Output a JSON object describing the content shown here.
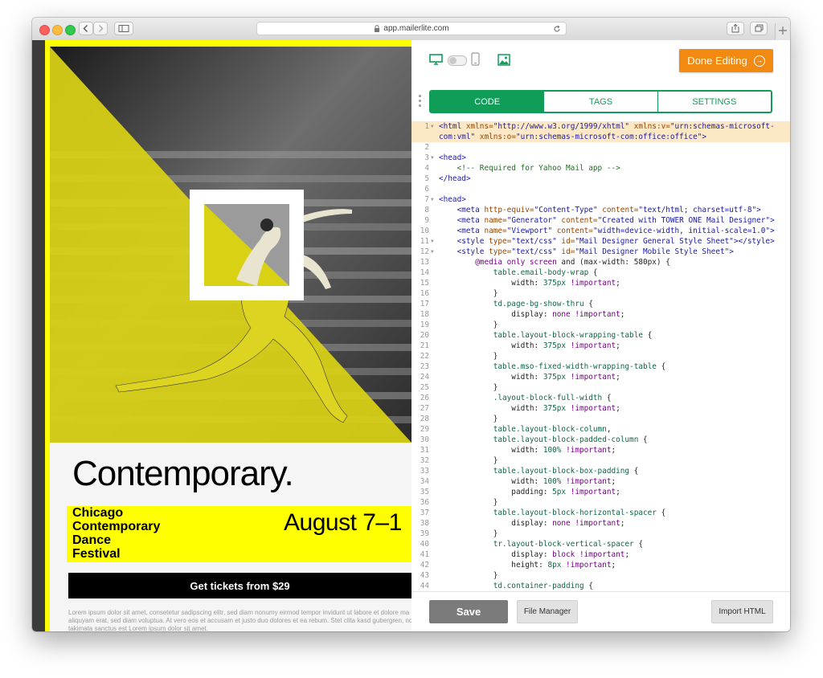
{
  "browser": {
    "url": "app.mailerlite.com"
  },
  "email": {
    "headline": "Contemporary.",
    "festival_lines": [
      "Chicago",
      "Contemporary",
      "Dance",
      "Festival"
    ],
    "dates": "August 7–1",
    "cta_label": "Get tickets from $29",
    "body_lines": [
      "Lorem ipsum dolor sit amet, consetetur sadipscing elitr, sed diam nonumy eirmod tempor invidunt ut labore et dolore ma",
      "aliquyam erat, sed diam voluptua. At vero eos et accusam et justo duo dolores et ea rebum. Stet clita kasd gubergren, no",
      "takimata sanctus est Lorem ipsum dolor sit amet."
    ],
    "colors": {
      "accent": "#ffff00",
      "text": "#000000"
    }
  },
  "editor": {
    "done_label": "Done Editing",
    "tabs": [
      {
        "label": "CODE",
        "active": true
      },
      {
        "label": "TAGS",
        "active": false
      },
      {
        "label": "SETTINGS",
        "active": false
      }
    ],
    "code_lines": [
      {
        "n": "1",
        "fold": true,
        "hl": true,
        "segs": [
          [
            "t",
            "<html "
          ],
          [
            "a",
            "xmlns="
          ],
          [
            "s",
            "\"http://www.w3.org/1999/xhtml\" "
          ],
          [
            "a",
            "xmlns:v="
          ],
          [
            "s",
            "\"urn:schemas-microsoft-"
          ]
        ]
      },
      {
        "n": "",
        "fold": false,
        "hl": true,
        "segs": [
          [
            "s",
            "com:vml\" "
          ],
          [
            "a",
            "xmlns:o="
          ],
          [
            "s",
            "\"urn:schemas-microsoft-com:office:office\""
          ],
          [
            "t",
            ">"
          ]
        ]
      },
      {
        "n": "2",
        "fold": false,
        "hl": false,
        "segs": []
      },
      {
        "n": "3",
        "fold": true,
        "hl": false,
        "segs": [
          [
            "t",
            "<head>"
          ]
        ]
      },
      {
        "n": "4",
        "fold": false,
        "hl": false,
        "segs": [
          [
            "p",
            "    "
          ],
          [
            "c",
            "<!-- Required for Yahoo Mail app -->"
          ]
        ]
      },
      {
        "n": "5",
        "fold": false,
        "hl": false,
        "segs": [
          [
            "t",
            "</head>"
          ]
        ]
      },
      {
        "n": "6",
        "fold": false,
        "hl": false,
        "segs": []
      },
      {
        "n": "7",
        "fold": true,
        "hl": false,
        "segs": [
          [
            "t",
            "<head>"
          ]
        ]
      },
      {
        "n": "8",
        "fold": false,
        "hl": false,
        "segs": [
          [
            "p",
            "    "
          ],
          [
            "t",
            "<meta "
          ],
          [
            "a",
            "http-equiv="
          ],
          [
            "s",
            "\"Content-Type\" "
          ],
          [
            "a",
            "content="
          ],
          [
            "s",
            "\"text/html; charset=utf-8\""
          ],
          [
            "t",
            ">"
          ]
        ]
      },
      {
        "n": "9",
        "fold": false,
        "hl": false,
        "segs": [
          [
            "p",
            "    "
          ],
          [
            "t",
            "<meta "
          ],
          [
            "a",
            "name="
          ],
          [
            "s",
            "\"Generator\" "
          ],
          [
            "a",
            "content="
          ],
          [
            "s",
            "\"Created with TOWER ONE Mail Designer\""
          ],
          [
            "t",
            ">"
          ]
        ]
      },
      {
        "n": "10",
        "fold": false,
        "hl": false,
        "segs": [
          [
            "p",
            "    "
          ],
          [
            "t",
            "<meta "
          ],
          [
            "a",
            "name="
          ],
          [
            "s",
            "\"Viewport\" "
          ],
          [
            "a",
            "content="
          ],
          [
            "s",
            "\"width=device-width, initial-scale=1.0\""
          ],
          [
            "t",
            ">"
          ]
        ]
      },
      {
        "n": "11",
        "fold": true,
        "hl": false,
        "segs": [
          [
            "p",
            "    "
          ],
          [
            "t",
            "<style "
          ],
          [
            "a",
            "type="
          ],
          [
            "s",
            "\"text/css\" "
          ],
          [
            "a",
            "id="
          ],
          [
            "s",
            "\"Mail Designer General Style Sheet\""
          ],
          [
            "t",
            "></style>"
          ]
        ]
      },
      {
        "n": "12",
        "fold": true,
        "hl": false,
        "segs": [
          [
            "p",
            "    "
          ],
          [
            "t",
            "<style "
          ],
          [
            "a",
            "type="
          ],
          [
            "s",
            "\"text/css\" "
          ],
          [
            "a",
            "id="
          ],
          [
            "s",
            "\"Mail Designer Mobile Style Sheet\""
          ],
          [
            "t",
            ">"
          ]
        ]
      },
      {
        "n": "13",
        "fold": false,
        "hl": false,
        "segs": [
          [
            "p",
            "        "
          ],
          [
            "k",
            "@media "
          ],
          [
            "k",
            "only screen "
          ],
          [
            "p",
            "and (max-width: 580px) {"
          ]
        ]
      },
      {
        "n": "14",
        "fold": false,
        "hl": false,
        "segs": [
          [
            "p",
            "            "
          ],
          [
            "g",
            "table.email-body-wrap "
          ],
          [
            "p",
            "{"
          ]
        ]
      },
      {
        "n": "15",
        "fold": false,
        "hl": false,
        "segs": [
          [
            "p",
            "                width: "
          ],
          [
            "g",
            "375px "
          ],
          [
            "k",
            "!important"
          ],
          [
            "p",
            ";"
          ]
        ]
      },
      {
        "n": "16",
        "fold": false,
        "hl": false,
        "segs": [
          [
            "p",
            "            }"
          ]
        ]
      },
      {
        "n": "17",
        "fold": false,
        "hl": false,
        "segs": [
          [
            "p",
            "            "
          ],
          [
            "g",
            "td.page-bg-show-thru "
          ],
          [
            "p",
            "{"
          ]
        ]
      },
      {
        "n": "18",
        "fold": false,
        "hl": false,
        "segs": [
          [
            "p",
            "                display: "
          ],
          [
            "k",
            "none "
          ],
          [
            "k",
            "!important"
          ],
          [
            "p",
            ";"
          ]
        ]
      },
      {
        "n": "19",
        "fold": false,
        "hl": false,
        "segs": [
          [
            "p",
            "            }"
          ]
        ]
      },
      {
        "n": "20",
        "fold": false,
        "hl": false,
        "segs": [
          [
            "p",
            "            "
          ],
          [
            "g",
            "table.layout-block-wrapping-table "
          ],
          [
            "p",
            "{"
          ]
        ]
      },
      {
        "n": "21",
        "fold": false,
        "hl": false,
        "segs": [
          [
            "p",
            "                width: "
          ],
          [
            "g",
            "375px "
          ],
          [
            "k",
            "!important"
          ],
          [
            "p",
            ";"
          ]
        ]
      },
      {
        "n": "22",
        "fold": false,
        "hl": false,
        "segs": [
          [
            "p",
            "            }"
          ]
        ]
      },
      {
        "n": "23",
        "fold": false,
        "hl": false,
        "segs": [
          [
            "p",
            "            "
          ],
          [
            "g",
            "table.mso-fixed-width-wrapping-table "
          ],
          [
            "p",
            "{"
          ]
        ]
      },
      {
        "n": "24",
        "fold": false,
        "hl": false,
        "segs": [
          [
            "p",
            "                width: "
          ],
          [
            "g",
            "375px "
          ],
          [
            "k",
            "!important"
          ],
          [
            "p",
            ";"
          ]
        ]
      },
      {
        "n": "25",
        "fold": false,
        "hl": false,
        "segs": [
          [
            "p",
            "            }"
          ]
        ]
      },
      {
        "n": "26",
        "fold": false,
        "hl": false,
        "segs": [
          [
            "p",
            "            "
          ],
          [
            "g",
            ".layout-block-full-width "
          ],
          [
            "p",
            "{"
          ]
        ]
      },
      {
        "n": "27",
        "fold": false,
        "hl": false,
        "segs": [
          [
            "p",
            "                width: "
          ],
          [
            "g",
            "375px "
          ],
          [
            "k",
            "!important"
          ],
          [
            "p",
            ";"
          ]
        ]
      },
      {
        "n": "28",
        "fold": false,
        "hl": false,
        "segs": [
          [
            "p",
            "            }"
          ]
        ]
      },
      {
        "n": "29",
        "fold": false,
        "hl": false,
        "segs": [
          [
            "p",
            "            "
          ],
          [
            "g",
            "table.layout-block-column"
          ],
          [
            "p",
            ","
          ]
        ]
      },
      {
        "n": "30",
        "fold": false,
        "hl": false,
        "segs": [
          [
            "p",
            "            "
          ],
          [
            "g",
            "table.layout-block-padded-column "
          ],
          [
            "p",
            "{"
          ]
        ]
      },
      {
        "n": "31",
        "fold": false,
        "hl": false,
        "segs": [
          [
            "p",
            "                width: "
          ],
          [
            "g",
            "100% "
          ],
          [
            "k",
            "!important"
          ],
          [
            "p",
            ";"
          ]
        ]
      },
      {
        "n": "32",
        "fold": false,
        "hl": false,
        "segs": [
          [
            "p",
            "            }"
          ]
        ]
      },
      {
        "n": "33",
        "fold": false,
        "hl": false,
        "segs": [
          [
            "p",
            "            "
          ],
          [
            "g",
            "table.layout-block-box-padding "
          ],
          [
            "p",
            "{"
          ]
        ]
      },
      {
        "n": "34",
        "fold": false,
        "hl": false,
        "segs": [
          [
            "p",
            "                width: "
          ],
          [
            "g",
            "100% "
          ],
          [
            "k",
            "!important"
          ],
          [
            "p",
            ";"
          ]
        ]
      },
      {
        "n": "35",
        "fold": false,
        "hl": false,
        "segs": [
          [
            "p",
            "                padding: "
          ],
          [
            "g",
            "5px "
          ],
          [
            "k",
            "!important"
          ],
          [
            "p",
            ";"
          ]
        ]
      },
      {
        "n": "36",
        "fold": false,
        "hl": false,
        "segs": [
          [
            "p",
            "            }"
          ]
        ]
      },
      {
        "n": "37",
        "fold": false,
        "hl": false,
        "segs": [
          [
            "p",
            "            "
          ],
          [
            "g",
            "table.layout-block-horizontal-spacer "
          ],
          [
            "p",
            "{"
          ]
        ]
      },
      {
        "n": "38",
        "fold": false,
        "hl": false,
        "segs": [
          [
            "p",
            "                display: "
          ],
          [
            "k",
            "none "
          ],
          [
            "k",
            "!important"
          ],
          [
            "p",
            ";"
          ]
        ]
      },
      {
        "n": "39",
        "fold": false,
        "hl": false,
        "segs": [
          [
            "p",
            "            }"
          ]
        ]
      },
      {
        "n": "40",
        "fold": false,
        "hl": false,
        "segs": [
          [
            "p",
            "            "
          ],
          [
            "g",
            "tr.layout-block-vertical-spacer "
          ],
          [
            "p",
            "{"
          ]
        ]
      },
      {
        "n": "41",
        "fold": false,
        "hl": false,
        "segs": [
          [
            "p",
            "                display: "
          ],
          [
            "k",
            "block "
          ],
          [
            "k",
            "!important"
          ],
          [
            "p",
            ";"
          ]
        ]
      },
      {
        "n": "42",
        "fold": false,
        "hl": false,
        "segs": [
          [
            "p",
            "                height: "
          ],
          [
            "g",
            "8px "
          ],
          [
            "k",
            "!important"
          ],
          [
            "p",
            ";"
          ]
        ]
      },
      {
        "n": "43",
        "fold": false,
        "hl": false,
        "segs": [
          [
            "p",
            "            }"
          ]
        ]
      },
      {
        "n": "44",
        "fold": false,
        "hl": false,
        "segs": [
          [
            "p",
            "            "
          ],
          [
            "g",
            "td.container-padding "
          ],
          [
            "p",
            "{"
          ]
        ]
      }
    ],
    "footer": {
      "save_label": "Save",
      "file_manager_label": "File Manager",
      "import_label": "Import HTML"
    },
    "colors": {
      "brand": "#0f9d58",
      "done": "#f28a12"
    }
  }
}
